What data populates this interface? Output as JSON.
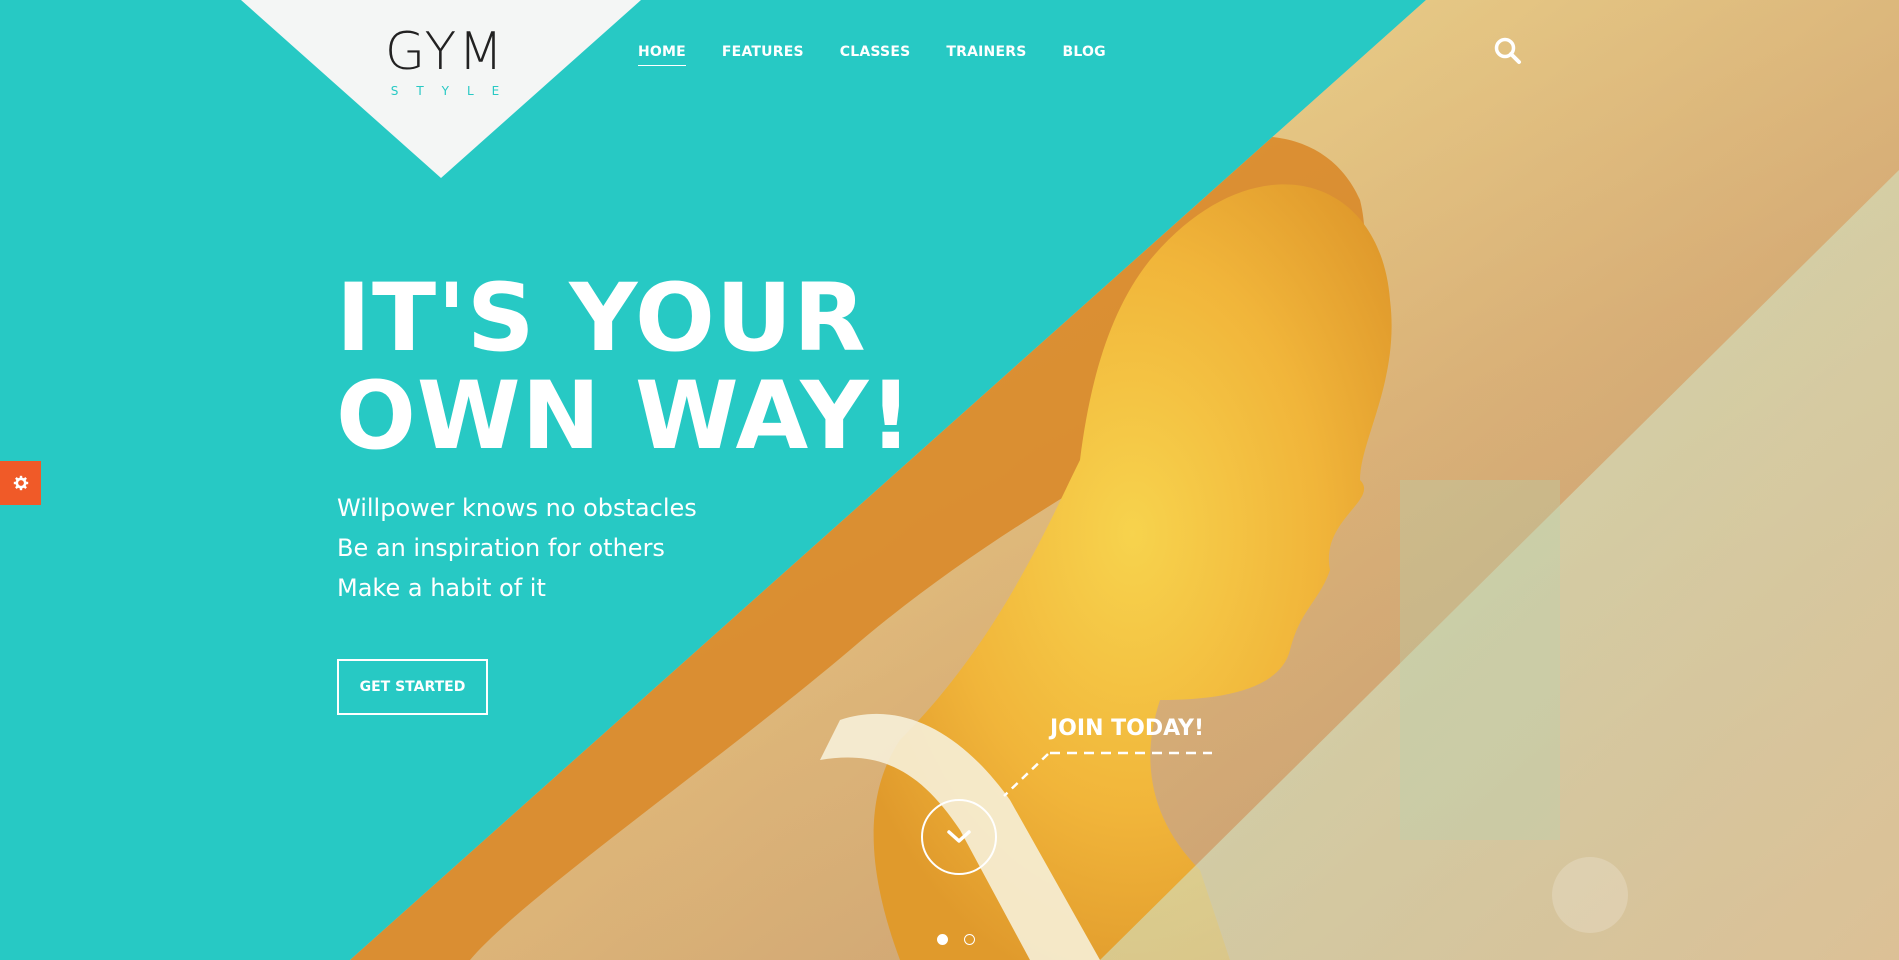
{
  "brand": {
    "name": "GYM",
    "sub": "STYLE"
  },
  "nav": {
    "items": [
      {
        "label": "HOME",
        "active": true
      },
      {
        "label": "FEATURES",
        "active": false
      },
      {
        "label": "CLASSES",
        "active": false
      },
      {
        "label": "TRAINERS",
        "active": false
      },
      {
        "label": "BLOG",
        "active": false
      }
    ]
  },
  "hero": {
    "headline_line1": "IT'S YOUR",
    "headline_line2": "OWN WAY!",
    "taglines": [
      "Willpower knows no obstacles",
      "Be an inspiration for others",
      "Make a habit of it"
    ],
    "cta_label": "GET STARTED",
    "join_label": "JOIN TODAY!"
  },
  "slider": {
    "slides": 2,
    "current": 1
  },
  "colors": {
    "teal": "#27c9c4",
    "accent": "#f05a28",
    "logo_bg": "#f4f6f5"
  },
  "icons": {
    "search": "search-icon",
    "settings": "gear-icon",
    "scroll": "chevron-down-icon"
  }
}
